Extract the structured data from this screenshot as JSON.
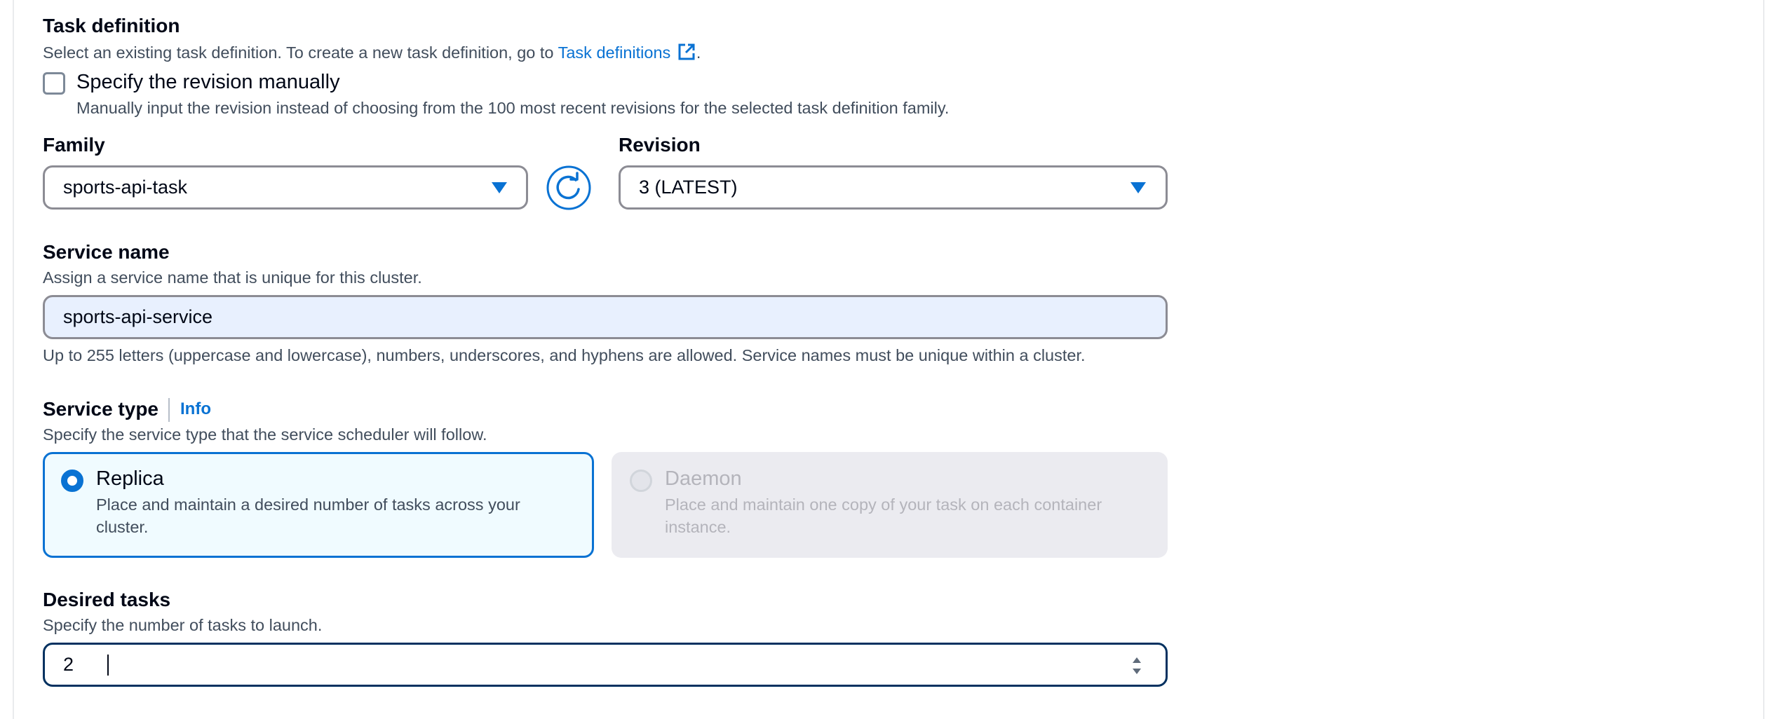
{
  "task_definition": {
    "heading": "Task definition",
    "description_prefix": "Select an existing task definition. To create a new task definition, go to",
    "link_label": "Task definitions",
    "description_suffix": "."
  },
  "manual_revision": {
    "label": "Specify the revision manually",
    "checked": false,
    "description": "Manually input the revision instead of choosing from the 100 most recent revisions for the selected task definition family."
  },
  "family": {
    "label": "Family",
    "value": "sports-api-task"
  },
  "revision": {
    "label": "Revision",
    "value": "3 (LATEST)"
  },
  "service_name": {
    "label": "Service name",
    "description": "Assign a service name that is unique for this cluster.",
    "value": "sports-api-service",
    "constraint": "Up to 255 letters (uppercase and lowercase), numbers, underscores, and hyphens are allowed. Service names must be unique within a cluster."
  },
  "service_type": {
    "label": "Service type",
    "info_label": "Info",
    "description": "Specify the service type that the service scheduler will follow.",
    "options": [
      {
        "label": "Replica",
        "description_line1": "Place and maintain a desired number of tasks across your",
        "description_line2": "cluster.",
        "selected": true,
        "disabled": false
      },
      {
        "label": "Daemon",
        "description_line1": "Place and maintain one copy of your task on each container",
        "description_line2": "instance.",
        "selected": false,
        "disabled": true
      }
    ]
  },
  "desired_tasks": {
    "label": "Desired tasks",
    "description": "Specify the number of tasks to launch.",
    "value": "2"
  },
  "colors": {
    "accent": "#0972d3",
    "focus_border": "#033160",
    "autofill_bg": "#e8f0fe",
    "selected_card_bg": "#f0fbff",
    "disabled_card_bg": "#ebebf0",
    "disabled_text": "#b4b4bb"
  },
  "icons": [
    "external-link-icon",
    "refresh-icon",
    "caret-down-icon",
    "stepper-icon"
  ]
}
